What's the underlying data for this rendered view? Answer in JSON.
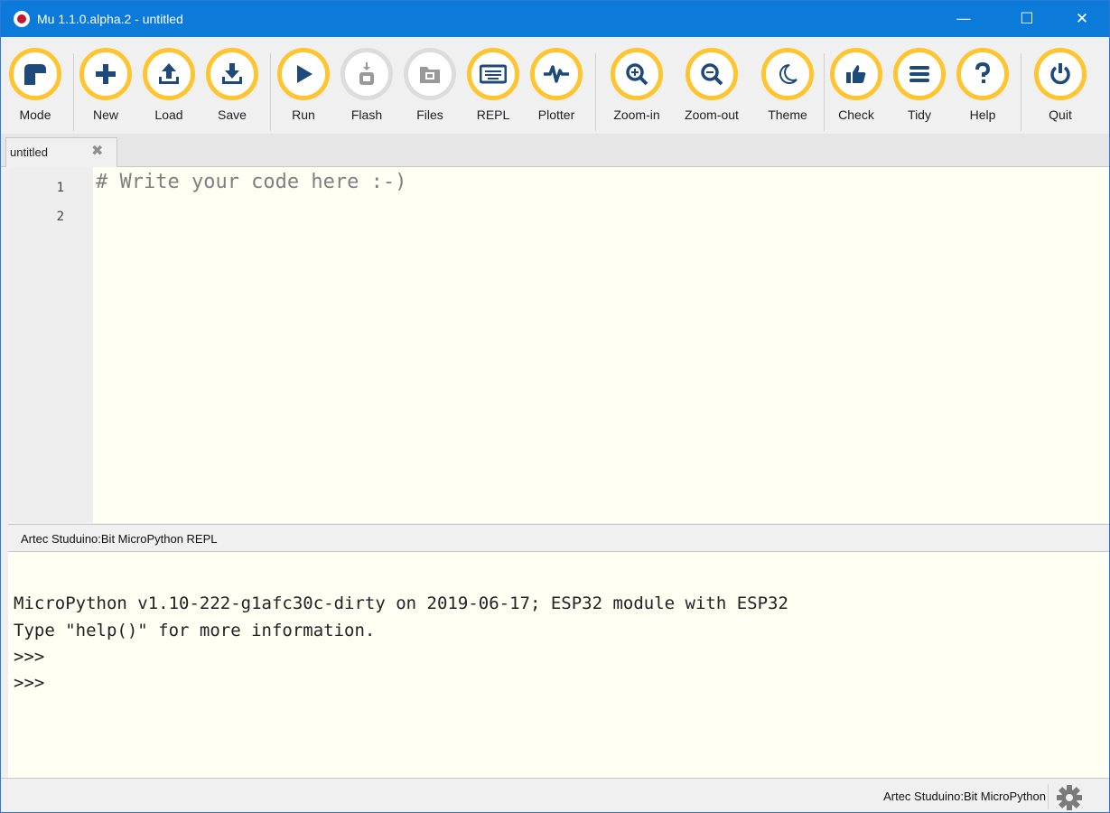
{
  "window": {
    "title": "Mu 1.1.0.alpha.2 - untitled",
    "minimize_glyph": "—",
    "maximize_glyph": "☐",
    "close_glyph": "✕"
  },
  "toolbar": {
    "accent_color": "#ffc530",
    "disabled_color": "#dcdcdc",
    "buttons": [
      {
        "label": "Mode",
        "icon": "mode-icon",
        "enabled": true
      },
      {
        "label": "New",
        "icon": "plus-icon",
        "enabled": true
      },
      {
        "label": "Load",
        "icon": "upload-icon",
        "enabled": true
      },
      {
        "label": "Save",
        "icon": "download-icon",
        "enabled": true
      },
      {
        "label": "Run",
        "icon": "play-icon",
        "enabled": true
      },
      {
        "label": "Flash",
        "icon": "flash-icon",
        "enabled": false
      },
      {
        "label": "Files",
        "icon": "files-icon",
        "enabled": false
      },
      {
        "label": "REPL",
        "icon": "keyboard-icon",
        "enabled": true
      },
      {
        "label": "Plotter",
        "icon": "pulse-icon",
        "enabled": true
      },
      {
        "label": "Zoom-in",
        "icon": "zoom-in-icon",
        "enabled": true
      },
      {
        "label": "Zoom-out",
        "icon": "zoom-out-icon",
        "enabled": true
      },
      {
        "label": "Theme",
        "icon": "moon-icon",
        "enabled": true
      },
      {
        "label": "Check",
        "icon": "thumbs-up-icon",
        "enabled": true
      },
      {
        "label": "Tidy",
        "icon": "lines-icon",
        "enabled": true
      },
      {
        "label": "Help",
        "icon": "question-icon",
        "enabled": true
      },
      {
        "label": "Quit",
        "icon": "power-icon",
        "enabled": true
      }
    ]
  },
  "tabs": [
    {
      "label": "untitled",
      "close_glyph": "✖"
    }
  ],
  "editor": {
    "line_numbers": [
      "1",
      "2"
    ],
    "code": "# Write your code here :-)"
  },
  "repl": {
    "title": "Artec Studuino:Bit MicroPython REPL",
    "lines": [
      "MicroPython v1.10-222-g1afc30c-dirty on 2019-06-17; ESP32 module with ESP32",
      "Type \"help()\" for more information.",
      ">>>",
      ">>>"
    ]
  },
  "status": {
    "mode": "Artec Studuino:Bit MicroPython"
  }
}
